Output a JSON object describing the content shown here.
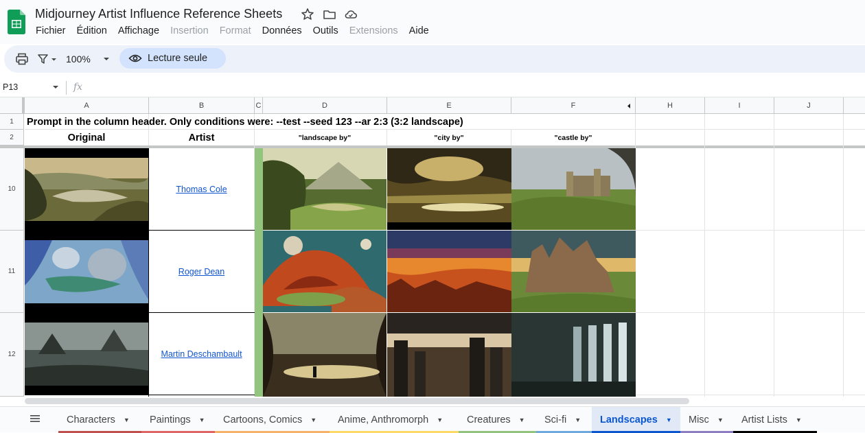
{
  "document": {
    "title": "Midjourney Artist Influence Reference Sheets"
  },
  "menu": [
    "Fichier",
    "Édition",
    "Affichage",
    "Insertion",
    "Format",
    "Données",
    "Outils",
    "Extensions",
    "Aide"
  ],
  "menu_disabled": [
    "Insertion",
    "Format",
    "Extensions"
  ],
  "toolbar": {
    "zoom": "100%",
    "readonly_label": "Lecture seule"
  },
  "formula_bar": {
    "name_box": "P13",
    "fx": "fx"
  },
  "columns": [
    "A",
    "B",
    "C",
    "D",
    "E",
    "F",
    "H",
    "I",
    "J"
  ],
  "rows": [
    "1",
    "2",
    "10",
    "11",
    "12"
  ],
  "cells": {
    "row1_prompt": "Prompt in the column header. Only conditions were:  --test --seed 123 --ar 2:3 (3:2 landscape)",
    "row2_original": "Original",
    "row2_artist": "Artist",
    "row2_landscape": "\"landscape by\"",
    "row2_city": "\"city by\"",
    "row2_castle": "\"castle by\""
  },
  "artists": [
    "Thomas Cole",
    "Roger Dean",
    "Martin Deschambault"
  ],
  "sheet_tabs": [
    {
      "label": "Characters",
      "color": "#c0504d"
    },
    {
      "label": "Paintings",
      "color": "#e06666"
    },
    {
      "label": "Cartoons, Comics",
      "color": "#f6b26b"
    },
    {
      "label": "Anime, Anthromorph",
      "color": "#ffd966"
    },
    {
      "label": "Creatures",
      "color": "#93c47d"
    },
    {
      "label": "Sci-fi",
      "color": "#6fa8dc"
    },
    {
      "label": "Landscapes",
      "color": "#0b57d0"
    },
    {
      "label": "Misc",
      "color": "#8e7cc3"
    },
    {
      "label": "Artist Lists",
      "color": "#000000"
    }
  ],
  "active_tab": "Landscapes",
  "colors": {
    "accent": "#0b57d0",
    "link": "#1155cc",
    "chip": "#d3e3fd",
    "toolbar_bg": "#edf2fa",
    "column_c_fill": "#93c47d"
  }
}
